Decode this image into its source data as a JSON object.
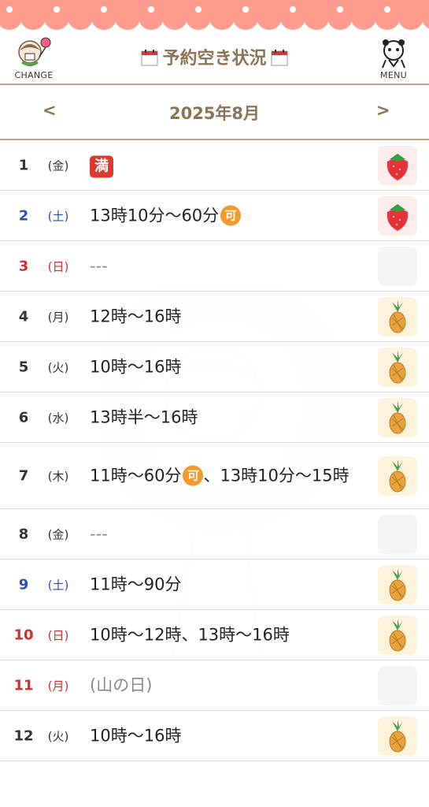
{
  "header": {
    "change_label": "CHANGE",
    "menu_label": "MENU",
    "title": "予約空き状況"
  },
  "month": {
    "title": "2025年8月",
    "prev": "<",
    "next": ">"
  },
  "colors": {
    "accent": "#8a7356",
    "scallop": "#ff9c8f",
    "saturday": "#2a4ec2",
    "sunday": "#d92a2a"
  },
  "rows": [
    {
      "day": "1",
      "weekday": "(金)",
      "color": "blk",
      "text": "",
      "badge": "満",
      "icon": "strawberry-icon"
    },
    {
      "day": "2",
      "weekday": "(土)",
      "color": "blue",
      "text": "13時10分〜60分",
      "badge": "可",
      "icon": "strawberry-icon"
    },
    {
      "day": "3",
      "weekday": "(日)",
      "color": "red",
      "text": "---",
      "icon": "empty-icon"
    },
    {
      "day": "4",
      "weekday": "(月)",
      "color": "blk",
      "text": "12時〜16時",
      "icon": "pineapple-icon"
    },
    {
      "day": "5",
      "weekday": "(火)",
      "color": "blk",
      "text": "10時〜16時",
      "icon": "pineapple-icon"
    },
    {
      "day": "6",
      "weekday": "(水)",
      "color": "blk",
      "text": "13時半〜16時",
      "icon": "pineapple-icon"
    },
    {
      "day": "7",
      "weekday": "(木)",
      "color": "blk",
      "text_a": "11時〜60分",
      "badge": "可",
      "text_b": "、13時10分〜15時",
      "icon": "pineapple-icon"
    },
    {
      "day": "8",
      "weekday": "(金)",
      "color": "blk",
      "text": "---",
      "icon": "empty-icon"
    },
    {
      "day": "9",
      "weekday": "(土)",
      "color": "blue",
      "text": "11時〜90分",
      "icon": "pineapple-icon"
    },
    {
      "day": "10",
      "weekday": "(日)",
      "color": "red",
      "text": "10時〜12時、13時〜16時",
      "icon": "pineapple-icon"
    },
    {
      "day": "11",
      "weekday": "(月)",
      "color": "red",
      "text": "(山の日)",
      "icon": "empty-icon"
    },
    {
      "day": "12",
      "weekday": "(火)",
      "color": "blk",
      "text": "10時〜16時",
      "icon": "pineapple-icon"
    }
  ]
}
